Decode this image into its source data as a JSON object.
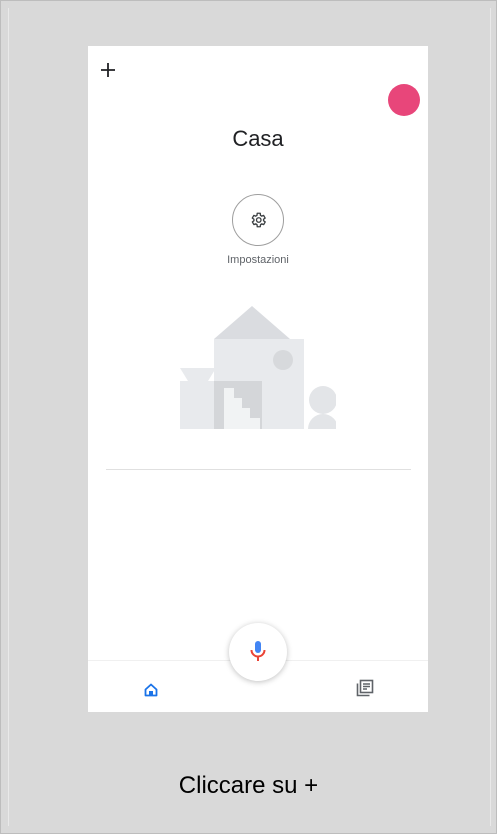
{
  "header": {
    "add_label": "+"
  },
  "home": {
    "title": "Casa"
  },
  "settings": {
    "label": "Impostazioni"
  },
  "caption": {
    "text": "Cliccare su +"
  },
  "colors": {
    "frame": "#d9d9d9",
    "avatar": "#e8467a",
    "nav_active": "#1a73e8",
    "nav_inactive": "#5f6368",
    "mic_blue": "#4285f4",
    "mic_red": "#ea4335"
  },
  "icons": {
    "settings": "gear-icon",
    "mic": "mic-icon",
    "home_tab": "home-icon",
    "feed_tab": "feed-icon"
  }
}
